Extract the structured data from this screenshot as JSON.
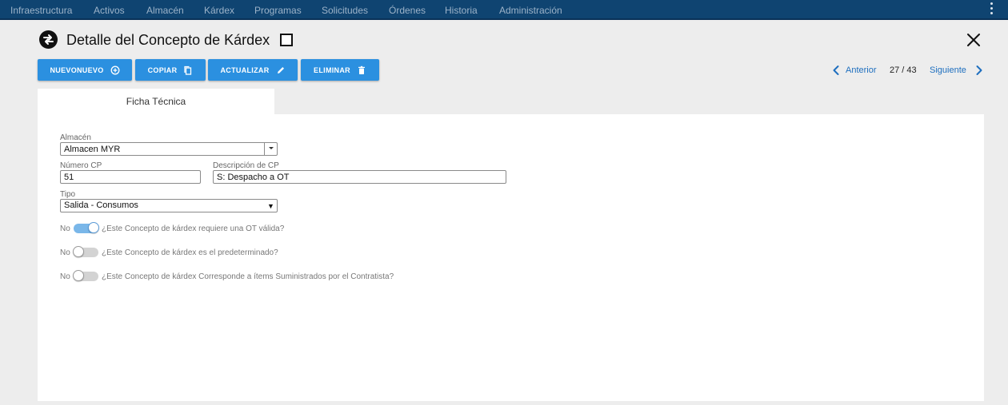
{
  "nav": {
    "items": [
      "Infraestructura",
      "Activos",
      "Almacén",
      "Kárdex",
      "Programas",
      "Solicitudes",
      "Órdenes",
      "Historia",
      "Administración"
    ]
  },
  "header": {
    "title": "Detalle del Concepto de Kárdex",
    "icon": "swap-arrows-icon"
  },
  "toolbar": {
    "nuevo_label": "NuevoNuevo",
    "copiar_label": "Copiar",
    "actualizar_label": "Actualizar",
    "eliminar_label": "Eliminar",
    "button_color": "#2b90e0"
  },
  "pager": {
    "prev_label": "Anterior",
    "count": "27 / 43",
    "next_label": "Siguiente"
  },
  "tabs": [
    {
      "label": "Ficha Técnica"
    }
  ],
  "form": {
    "almacen_label": "Almacén",
    "almacen_value": "Almacen MYR",
    "numero_label": "Número CP",
    "numero_value": "51",
    "descripcion_label": "Descripción de CP",
    "descripcion_value": "S: Despacho a OT",
    "tipo_label": "Tipo",
    "tipo_value": "Salida - Consumos",
    "toggles": [
      {
        "state": "No",
        "on": true,
        "text": "¿Este Concepto de kárdex requiere una OT válida?"
      },
      {
        "state": "No",
        "on": false,
        "text": "¿Este Concepto de kárdex es el predeterminado?"
      },
      {
        "state": "No",
        "on": false,
        "text": "¿Este Concepto de kárdex Corresponde a ítems Suministrados por el Contratista?"
      }
    ]
  },
  "colors": {
    "nav_bg": "#0f4471",
    "link": "#1e6fbf",
    "toggle_on": "#7ab7e9"
  }
}
